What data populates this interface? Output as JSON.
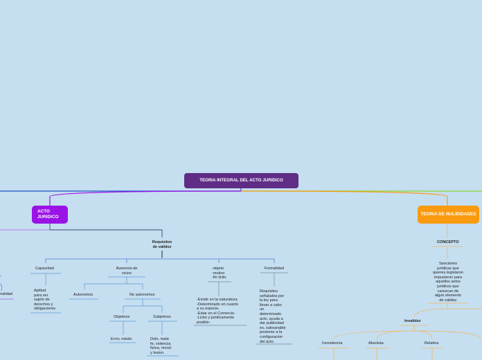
{
  "root": {
    "label": "TEORIA INTEGRAL DEL ACTO JURIDICO"
  },
  "branches": {
    "acto": {
      "label": "ACTO\nJURIDICO"
    },
    "teoria": {
      "label": "TEORIA DE\nNULIDIDADES"
    }
  },
  "acto_tree": {
    "requisitos": "Requisitos\nde validez",
    "capacidad": "Capacidad",
    "capacidad_desc": "Aptitud\npara ser\nsujeto de\nderechos y\nobligaciones",
    "ausencia": "Ausencia de\nvicios",
    "autonomos": "Autonomos",
    "no_autonomos": "No autonomos",
    "objetivos": "Objetivos",
    "objetivos_desc": "Error, miedo",
    "subjetivos": "Subjetivos",
    "subjetivos_desc": "Dolo, mala\nfe, violencia\nfisica, moral\ny lesion.",
    "objeto": "-objeto\n-motivo\n-fin licito",
    "objeto_desc": "-Existir en la naturaleza.\n-Determinado en cuanto\na su especie.\n-Estar en el Comercio.\n-Licito y juridicamente\nposible-",
    "formalidad": "Formalidad",
    "formalidad_desc": "Requisitos\nseñalados por\nla ley para\nllevar a cabo\nun\ndeterminado\nacto, ayuda a\ndar publicidad\nes, subsanable\nposterior a la\nconfiguracion\ndel acto."
  },
  "left_partial": {
    "item": "nalidad"
  },
  "teoria_tree": {
    "concepto": "CONCEPTO",
    "concepto_desc": "Sanciones\njuridicas que\nquieres legislaron\nimpusieron para\naquellos actos\njuridicos que\ncarezcan de\nalgun elemento\nde validez",
    "invalidez": "Invalidez",
    "inexistencia": "Inexistencia",
    "absoluta": "Absoluta",
    "relativa": "Relativa"
  },
  "colors": {
    "background": "#c5def0",
    "root": "#5f2c86",
    "acto": "#9a13e6",
    "teoria": "#f99a0f",
    "link_left": "#1a55c9",
    "link_right": "#8ed62e"
  }
}
